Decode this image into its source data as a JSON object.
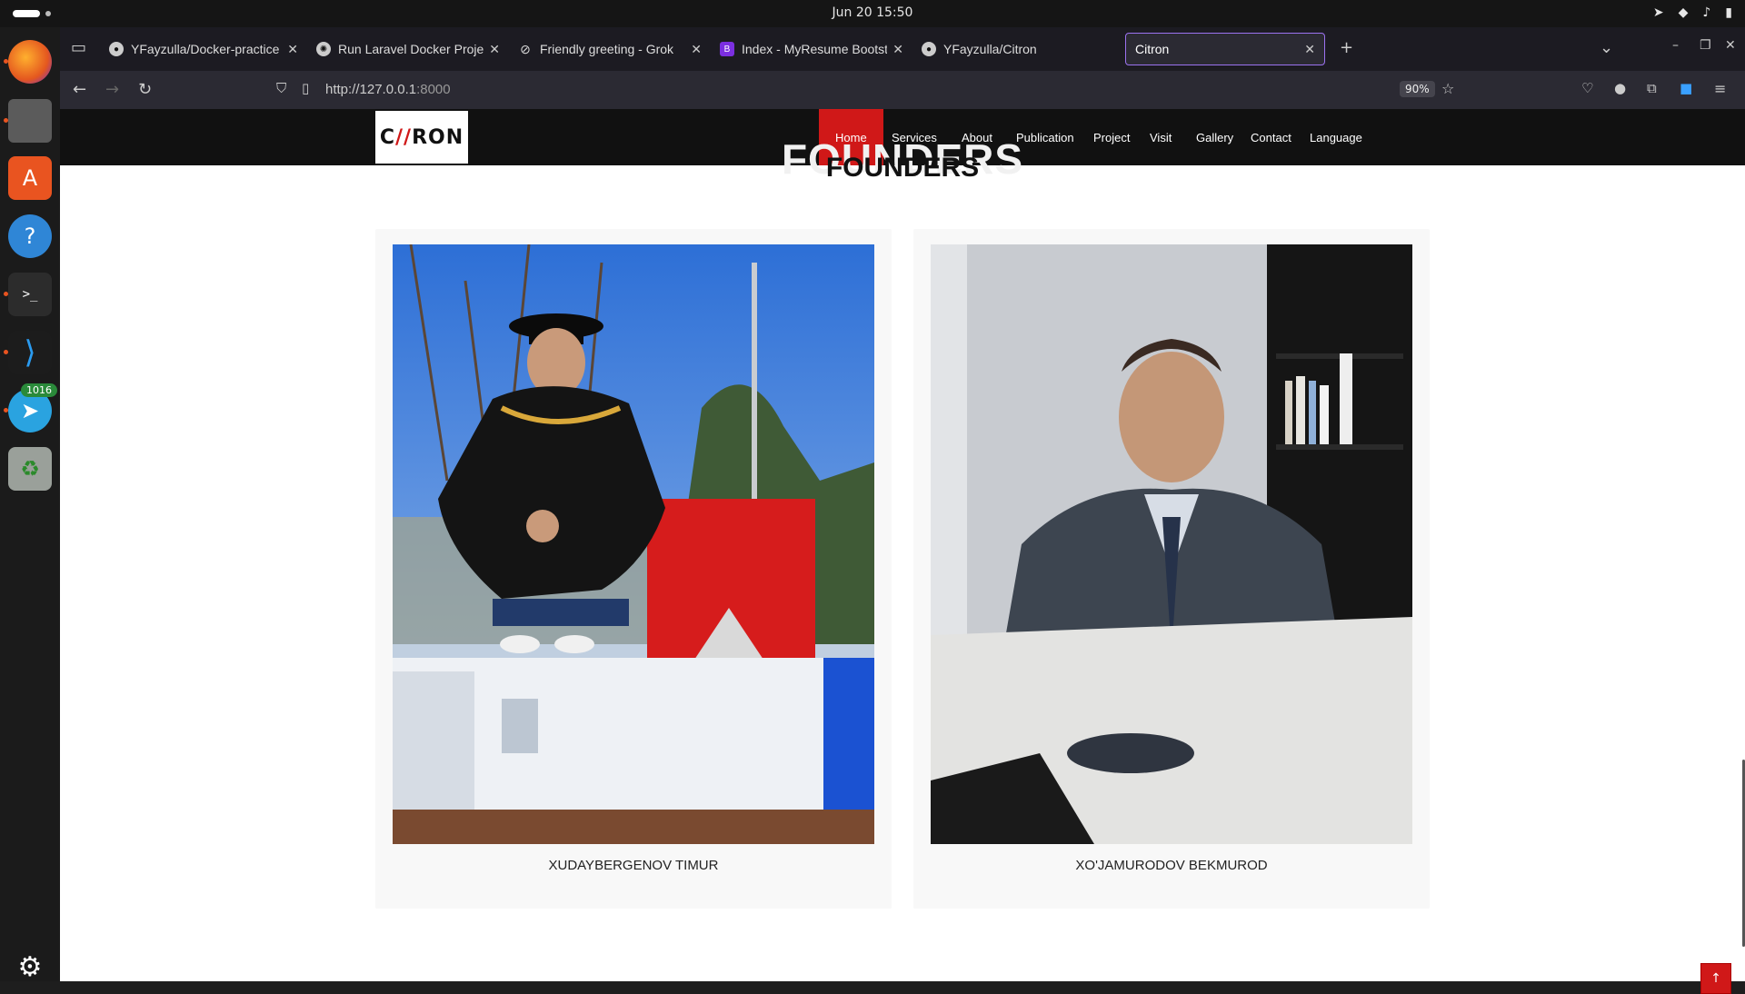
{
  "system": {
    "datetime": "Jun 20  15:50"
  },
  "dock": {
    "items": [
      {
        "name": "firefox-icon"
      },
      {
        "name": "files-icon"
      },
      {
        "name": "app-center-icon"
      },
      {
        "name": "help-icon"
      },
      {
        "name": "terminal-icon"
      },
      {
        "name": "vscode-icon"
      },
      {
        "name": "telegram-icon",
        "badge": "1016"
      },
      {
        "name": "trash-icon"
      },
      {
        "name": "show-apps-icon"
      }
    ]
  },
  "browser": {
    "tabs": [
      {
        "label": "YFayzulla/Docker-practice",
        "favicon": "github"
      },
      {
        "label": "Run Laravel Docker Proje",
        "favicon": "chatgpt"
      },
      {
        "label": "Friendly greeting - Grok",
        "favicon": "grok"
      },
      {
        "label": "Index - MyResume Bootst",
        "favicon": "bootstrap"
      },
      {
        "label": "YFayzulla/Citron",
        "favicon": "github"
      },
      {
        "label": "Citron",
        "favicon": "none",
        "active": true
      }
    ],
    "url_host": "http://127.0.0.1",
    "url_port": ":8000",
    "zoom": "90%"
  },
  "site": {
    "logo_text_left": "C",
    "logo_text_red": "//",
    "logo_text_right": "R",
    "logo_text_o": "O",
    "logo_text_n": "N",
    "menu": [
      {
        "label": "Home",
        "active": true
      },
      {
        "label": "Services"
      },
      {
        "label": "About"
      },
      {
        "label": "Publication"
      },
      {
        "label": "Project"
      },
      {
        "label": "Visit"
      },
      {
        "label": "Gallery"
      },
      {
        "label": "Contact"
      },
      {
        "label": "Language"
      }
    ],
    "section_ghost": "FOUNDERS",
    "section_title": "FOUNDERS",
    "founders": [
      {
        "name": "XUDAYBERGENOV TIMUR"
      },
      {
        "name": "XO'JAMURODOV BEKMUROD"
      }
    ]
  },
  "colors": {
    "accent": "#d01818",
    "header_bg": "#111111",
    "browser_chrome": "#2b2a33"
  }
}
